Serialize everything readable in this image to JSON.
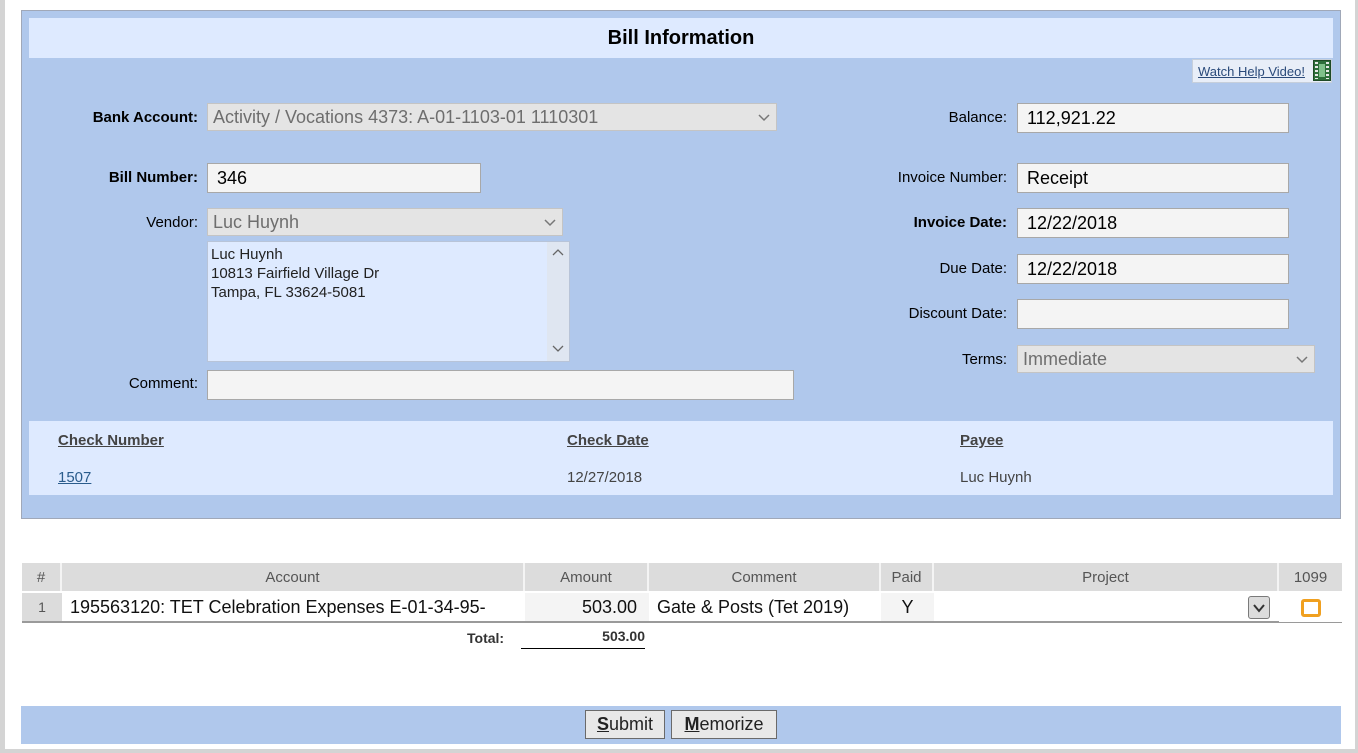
{
  "panel": {
    "title": "Bill Information",
    "help_link": "Watch Help Video!"
  },
  "form": {
    "bank_account_label": "Bank Account:",
    "bank_account_value": "Activity / Vocations 4373: A-01-1103-01 1110301",
    "bill_number_label": "Bill Number:",
    "bill_number_value": "346",
    "vendor_label": "Vendor:",
    "vendor_value": "Luc Huynh",
    "address_lines": [
      "Luc Huynh",
      "10813 Fairfield Village Dr",
      "Tampa, FL 33624-5081"
    ],
    "comment_label": "Comment:",
    "comment_value": "",
    "balance_label": "Balance:",
    "balance_value": "112,921.22",
    "invoice_number_label": "Invoice Number:",
    "invoice_number_value": "Receipt",
    "invoice_date_label": "Invoice Date:",
    "invoice_date_value": "12/22/2018",
    "due_date_label": "Due Date:",
    "due_date_value": "12/22/2018",
    "discount_date_label": "Discount Date:",
    "discount_date_value": "",
    "terms_label": "Terms:",
    "terms_value": "Immediate"
  },
  "checks": {
    "headers": [
      "Check Number",
      "Check Date",
      "Payee"
    ],
    "row": {
      "number": "1507",
      "date": "12/27/2018",
      "payee": "Luc Huynh"
    }
  },
  "lines": {
    "headers": [
      "#",
      "Account",
      "Amount",
      "Comment",
      "Paid",
      "Project",
      "1099"
    ],
    "rows": [
      {
        "num": "1",
        "account": "195563120: TET Celebration Expenses E-01-34-95-",
        "amount": "503.00",
        "comment": "Gate & Posts (Tet 2019)",
        "paid": "Y",
        "project": ""
      }
    ],
    "total_label": "Total:",
    "total_value": "503.00"
  },
  "footer": {
    "submit_key": "S",
    "submit_rest": "ubmit",
    "memorize_key": "M",
    "memorize_rest": "emorize"
  },
  "colors": {
    "panel_bg": "#b0c8ec",
    "title_bg": "#deeaff",
    "checkbox_highlight": "#f0a020"
  }
}
